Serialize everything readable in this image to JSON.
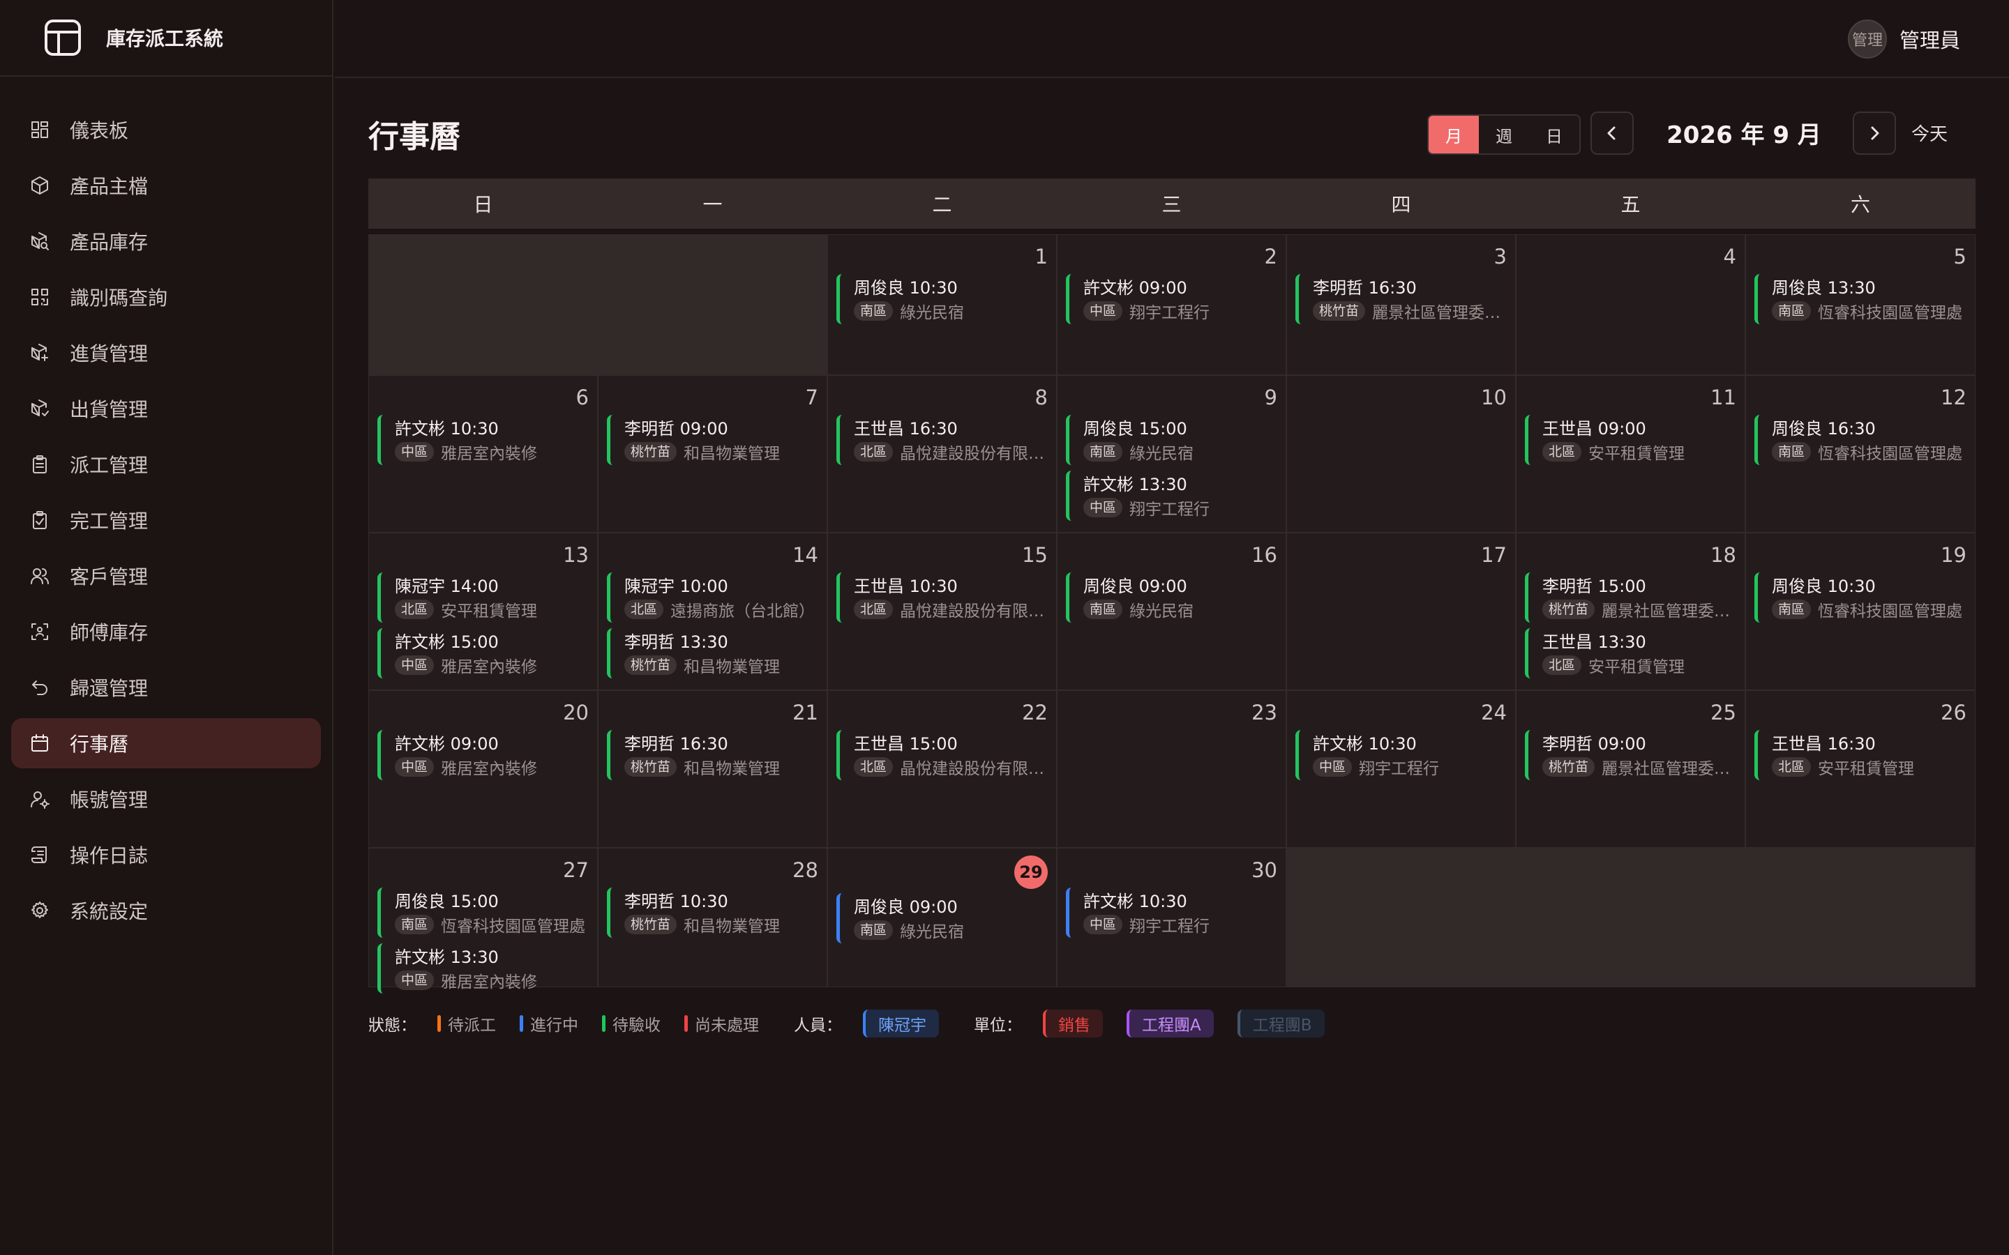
{
  "app": {
    "title": "庫存派工系統"
  },
  "user": {
    "avatar_text": "管理",
    "name": "管理員"
  },
  "sidebar": {
    "items": [
      {
        "label": "儀表板",
        "icon": "dashboard-icon"
      },
      {
        "label": "產品主檔",
        "icon": "box-icon"
      },
      {
        "label": "產品庫存",
        "icon": "box-search-icon"
      },
      {
        "label": "識別碼查詢",
        "icon": "qr-scan-icon"
      },
      {
        "label": "進貨管理",
        "icon": "box-in-icon"
      },
      {
        "label": "出貨管理",
        "icon": "box-out-icon"
      },
      {
        "label": "派工管理",
        "icon": "clipboard-list-icon"
      },
      {
        "label": "完工管理",
        "icon": "clipboard-check-icon"
      },
      {
        "label": "客戶管理",
        "icon": "users-icon"
      },
      {
        "label": "師傅庫存",
        "icon": "scan-person-icon"
      },
      {
        "label": "歸還管理",
        "icon": "undo-icon"
      },
      {
        "label": "行事曆",
        "icon": "calendar-icon",
        "active": true
      },
      {
        "label": "帳號管理",
        "icon": "user-gear-icon"
      },
      {
        "label": "操作日誌",
        "icon": "scroll-icon"
      },
      {
        "label": "系統設定",
        "icon": "gear-icon"
      }
    ]
  },
  "page": {
    "title": "行事曆",
    "views": [
      "月",
      "週",
      "日"
    ],
    "active_view": "月",
    "month_label": "2026 年 9 月",
    "today_label": "今天"
  },
  "calendar": {
    "weekdays": [
      "日",
      "一",
      "二",
      "三",
      "四",
      "五",
      "六"
    ],
    "weeks": [
      [
        null,
        null,
        {
          "day": "1",
          "events": [
            {
              "title": "周俊良 10:30",
              "area": "南區",
              "customer": "綠光民宿"
            }
          ]
        },
        {
          "day": "2",
          "events": [
            {
              "title": "許文彬 09:00",
              "area": "中區",
              "customer": "翔宇工程行"
            }
          ]
        },
        {
          "day": "3",
          "events": [
            {
              "title": "李明哲 16:30",
              "area": "桃竹苗",
              "customer": "麗景社區管理委員會"
            }
          ]
        },
        {
          "day": "4",
          "events": []
        },
        {
          "day": "5",
          "events": [
            {
              "title": "周俊良 13:30",
              "area": "南區",
              "customer": "恆睿科技園區管理處"
            }
          ]
        }
      ],
      [
        {
          "day": "6",
          "events": [
            {
              "title": "許文彬 10:30",
              "area": "中區",
              "customer": "雅居室內裝修"
            }
          ]
        },
        {
          "day": "7",
          "events": [
            {
              "title": "李明哲 09:00",
              "area": "桃竹苗",
              "customer": "和昌物業管理"
            }
          ]
        },
        {
          "day": "8",
          "events": [
            {
              "title": "王世昌 16:30",
              "area": "北區",
              "customer": "晶悅建設股份有限公司"
            }
          ]
        },
        {
          "day": "9",
          "events": [
            {
              "title": "周俊良 15:00",
              "area": "南區",
              "customer": "綠光民宿"
            },
            {
              "title": "許文彬 13:30",
              "area": "中區",
              "customer": "翔宇工程行"
            }
          ]
        },
        {
          "day": "10",
          "events": []
        },
        {
          "day": "11",
          "events": [
            {
              "title": "王世昌 09:00",
              "area": "北區",
              "customer": "安平租賃管理"
            }
          ]
        },
        {
          "day": "12",
          "events": [
            {
              "title": "周俊良 16:30",
              "area": "南區",
              "customer": "恆睿科技園區管理處"
            }
          ]
        }
      ],
      [
        {
          "day": "13",
          "events": [
            {
              "title": "陳冠宇 14:00",
              "area": "北區",
              "customer": "安平租賃管理"
            },
            {
              "title": "許文彬 15:00",
              "area": "中區",
              "customer": "雅居室內裝修"
            }
          ]
        },
        {
          "day": "14",
          "events": [
            {
              "title": "陳冠宇 10:00",
              "area": "北區",
              "customer": "遠揚商旅（台北館）"
            },
            {
              "title": "李明哲 13:30",
              "area": "桃竹苗",
              "customer": "和昌物業管理"
            }
          ]
        },
        {
          "day": "15",
          "events": [
            {
              "title": "王世昌 10:30",
              "area": "北區",
              "customer": "晶悅建設股份有限公司"
            }
          ]
        },
        {
          "day": "16",
          "events": [
            {
              "title": "周俊良 09:00",
              "area": "南區",
              "customer": "綠光民宿"
            }
          ]
        },
        {
          "day": "17",
          "events": []
        },
        {
          "day": "18",
          "events": [
            {
              "title": "李明哲 15:00",
              "area": "桃竹苗",
              "customer": "麗景社區管理委員會"
            },
            {
              "title": "王世昌 13:30",
              "area": "北區",
              "customer": "安平租賃管理"
            }
          ]
        },
        {
          "day": "19",
          "events": [
            {
              "title": "周俊良 10:30",
              "area": "南區",
              "customer": "恆睿科技園區管理處"
            }
          ]
        }
      ],
      [
        {
          "day": "20",
          "events": [
            {
              "title": "許文彬 09:00",
              "area": "中區",
              "customer": "雅居室內裝修"
            }
          ]
        },
        {
          "day": "21",
          "events": [
            {
              "title": "李明哲 16:30",
              "area": "桃竹苗",
              "customer": "和昌物業管理"
            }
          ]
        },
        {
          "day": "22",
          "events": [
            {
              "title": "王世昌 15:00",
              "area": "北區",
              "customer": "晶悅建設股份有限公司"
            }
          ]
        },
        {
          "day": "23",
          "events": []
        },
        {
          "day": "24",
          "events": [
            {
              "title": "許文彬 10:30",
              "area": "中區",
              "customer": "翔宇工程行"
            }
          ]
        },
        {
          "day": "25",
          "events": [
            {
              "title": "李明哲 09:00",
              "area": "桃竹苗",
              "customer": "麗景社區管理委員會"
            }
          ]
        },
        {
          "day": "26",
          "events": [
            {
              "title": "王世昌 16:30",
              "area": "北區",
              "customer": "安平租賃管理"
            }
          ]
        }
      ],
      [
        {
          "day": "27",
          "events": [
            {
              "title": "周俊良 15:00",
              "area": "南區",
              "customer": "恆睿科技園區管理處"
            },
            {
              "title": "許文彬 13:30",
              "area": "中區",
              "customer": "雅居室內裝修"
            }
          ]
        },
        {
          "day": "28",
          "events": [
            {
              "title": "李明哲 10:30",
              "area": "桃竹苗",
              "customer": "和昌物業管理"
            }
          ]
        },
        {
          "day": "29",
          "today": true,
          "events": [
            {
              "title": "周俊良 09:00",
              "area": "南區",
              "customer": "綠光民宿",
              "status": "in-progress"
            }
          ]
        },
        {
          "day": "30",
          "events": [
            {
              "title": "許文彬 10:30",
              "area": "中區",
              "customer": "翔宇工程行",
              "status": "in-progress"
            }
          ]
        },
        null,
        null,
        null
      ]
    ]
  },
  "legend": {
    "status_label": "狀態：",
    "statuses": [
      {
        "label": "待派工",
        "color": "#f97316"
      },
      {
        "label": "進行中",
        "color": "#3b82f6"
      },
      {
        "label": "待驗收",
        "color": "#22c55e"
      },
      {
        "label": "尚未處理",
        "color": "#ef4444"
      }
    ],
    "people_label": "人員：",
    "people": [
      {
        "label": "陳冠宇",
        "color": "#3b82f6"
      }
    ],
    "unit_label": "單位：",
    "units": [
      {
        "label": "銷售",
        "color": "#ef4444"
      },
      {
        "label": "工程團A",
        "color": "#a855f7"
      },
      {
        "label": "工程團B",
        "color": "#475569"
      }
    ]
  }
}
